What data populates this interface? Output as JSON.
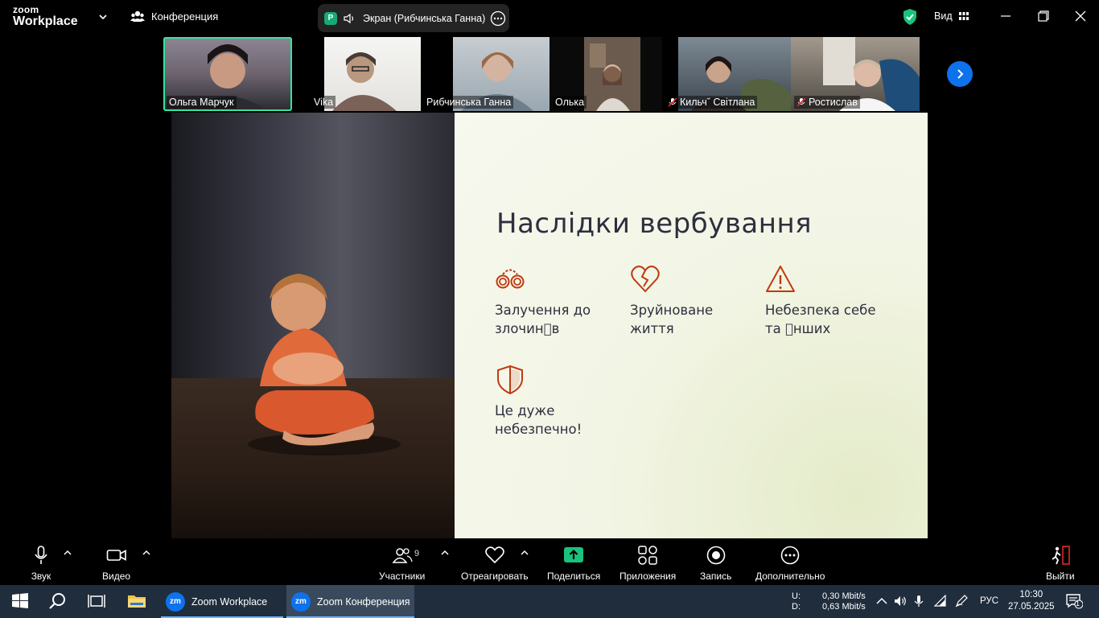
{
  "app": {
    "logo_line1": "zoom",
    "logo_line2": "Workplace",
    "meeting_label": "Конференция",
    "screen_share_label": "Экран (Рибчинська Ганна)",
    "screen_share_badge": "P",
    "view_label": "Вид"
  },
  "participants": [
    {
      "name": "Ольга Марчук",
      "muted": false,
      "active": true
    },
    {
      "name": "Vika",
      "muted": false,
      "active": false
    },
    {
      "name": "Рибчинська Ганна",
      "muted": false,
      "active": false
    },
    {
      "name": "Олька",
      "muted": false,
      "active": false
    },
    {
      "name": "Кильчˇ Світлана",
      "muted": true,
      "active": false
    },
    {
      "name": "Ростислав",
      "muted": true,
      "active": false
    }
  ],
  "slide": {
    "title": "Наслідки вербування",
    "items": [
      {
        "icon": "handcuffs-icon",
        "text": "Залучення до\nзлочин\u0000в"
      },
      {
        "icon": "broken-heart-icon",
        "text": "Зруйноване\nжиття"
      },
      {
        "icon": "warning-icon",
        "text": "Небезпека себе\nта \u0000нших"
      },
      {
        "icon": "shield-icon",
        "text": "Це дуже\nнебезпечно!"
      }
    ],
    "accent_color": "#c0390f"
  },
  "toolbar": {
    "audio": "Звук",
    "video": "Видео",
    "participants": "Участники",
    "participants_count": "9",
    "react": "Отреагировать",
    "share": "Поделиться",
    "apps": "Приложения",
    "record": "Запись",
    "more": "Дополнительно",
    "leave": "Выйти"
  },
  "taskbar": {
    "app1": "Zoom Workplace",
    "app2": "Zoom Конференция",
    "net_up_label": "U:",
    "net_up": "0,30 Mbit/s",
    "net_down_label": "D:",
    "net_down": "0,63 Mbit/s",
    "language": "РУС",
    "time": "10:30",
    "date": "27.05.2025",
    "notifications": "1"
  },
  "colors": {
    "zoom_blue": "#0e72ed",
    "share_green": "#19c37d",
    "active_speaker": "#2ee6a0",
    "leave_red": "#e02828"
  }
}
